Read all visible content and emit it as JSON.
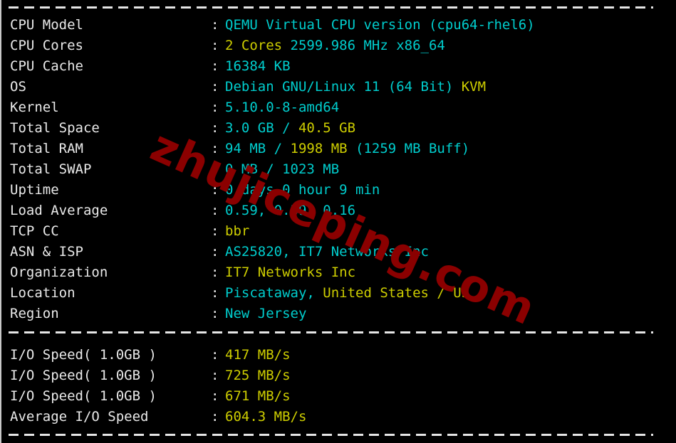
{
  "terminal": {
    "background_color": "#000000",
    "label_color": "#e9e9e9",
    "cyan_color": "#00cdcd",
    "yellow_color": "#cdcd00",
    "separator_color": "#e6e6e6",
    "colon": ":"
  },
  "watermark": {
    "text": "zhujiceping.com",
    "color": "#8b0000"
  },
  "system_info": {
    "rows": [
      {
        "label": "CPU Model",
        "value": "QEMU Virtual CPU version (cpu64-rhel6)",
        "parts": [
          {
            "text": "QEMU Virtual CPU version (cpu64-rhel6)",
            "color": "cyan"
          }
        ]
      },
      {
        "label": "CPU Cores",
        "value": "2 Cores 2599.986 MHz x86_64",
        "parts": [
          {
            "text": "2 Cores ",
            "color": "yellow"
          },
          {
            "text": "2599.986 MHz x86_64",
            "color": "cyan"
          }
        ]
      },
      {
        "label": "CPU Cache",
        "value": "16384 KB",
        "parts": [
          {
            "text": "16384 KB",
            "color": "cyan"
          }
        ]
      },
      {
        "label": "OS",
        "value": "Debian GNU/Linux 11 (64 Bit) KVM",
        "parts": [
          {
            "text": "Debian GNU/Linux 11 (64 Bit) ",
            "color": "cyan"
          },
          {
            "text": "KVM",
            "color": "yellow"
          }
        ]
      },
      {
        "label": "Kernel",
        "value": "5.10.0-8-amd64",
        "parts": [
          {
            "text": "5.10.0-8-amd64",
            "color": "cyan"
          }
        ]
      },
      {
        "label": "Total Space",
        "value": "3.0 GB / 40.5 GB",
        "parts": [
          {
            "text": "3.0 GB / ",
            "color": "cyan"
          },
          {
            "text": "40.5 GB",
            "color": "yellow"
          }
        ]
      },
      {
        "label": "Total RAM",
        "value": "94 MB / 1998 MB (1259 MB Buff)",
        "parts": [
          {
            "text": "94 MB / ",
            "color": "cyan"
          },
          {
            "text": "1998 MB",
            "color": "yellow"
          },
          {
            "text": " (1259 MB Buff)",
            "color": "cyan"
          }
        ]
      },
      {
        "label": "Total SWAP",
        "value": "0 MB / 1023 MB",
        "parts": [
          {
            "text": "0 MB / 1023 MB",
            "color": "cyan"
          }
        ]
      },
      {
        "label": "Uptime",
        "value": "0 days 0 hour 9 min",
        "parts": [
          {
            "text": "0 days 0 hour 9 min",
            "color": "cyan"
          }
        ]
      },
      {
        "label": "Load Average",
        "value": "0.59, 0.39, 0.16",
        "parts": [
          {
            "text": "0.59, 0.39, 0.16",
            "color": "cyan"
          }
        ]
      },
      {
        "label": "TCP CC",
        "value": "bbr",
        "parts": [
          {
            "text": "bbr",
            "color": "yellow"
          }
        ]
      },
      {
        "label": "ASN & ISP",
        "value": "AS25820, IT7 Networks Inc",
        "parts": [
          {
            "text": "AS25820, IT7 Networks Inc",
            "color": "cyan"
          }
        ]
      },
      {
        "label": "Organization",
        "value": "IT7 Networks Inc",
        "parts": [
          {
            "text": "IT7 Networks Inc",
            "color": "yellow"
          }
        ]
      },
      {
        "label": "Location",
        "value": "Piscataway, United States / US",
        "parts": [
          {
            "text": "Piscataway, ",
            "color": "cyan"
          },
          {
            "text": "United States / US",
            "color": "yellow"
          }
        ]
      },
      {
        "label": "Region",
        "value": "New Jersey",
        "parts": [
          {
            "text": "New Jersey",
            "color": "cyan"
          }
        ]
      }
    ]
  },
  "io_benchmark": {
    "rows": [
      {
        "label": "I/O Speed( 1.0GB )",
        "value": "417 MB/s",
        "parts": [
          {
            "text": "417 MB/s",
            "color": "yellow"
          }
        ]
      },
      {
        "label": "I/O Speed( 1.0GB )",
        "value": "725 MB/s",
        "parts": [
          {
            "text": "725 MB/s",
            "color": "yellow"
          }
        ]
      },
      {
        "label": "I/O Speed( 1.0GB )",
        "value": "671 MB/s",
        "parts": [
          {
            "text": "671 MB/s",
            "color": "yellow"
          }
        ]
      },
      {
        "label": "Average I/O Speed",
        "value": "604.3 MB/s",
        "parts": [
          {
            "text": "604.3 MB/s",
            "color": "yellow"
          }
        ]
      }
    ]
  }
}
